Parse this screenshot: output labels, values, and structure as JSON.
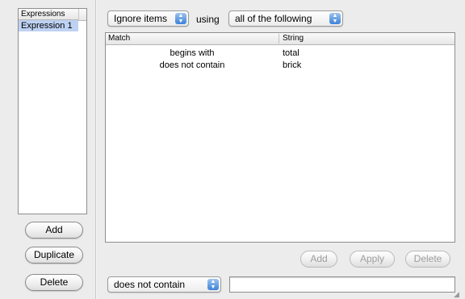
{
  "expressions": {
    "header": "Expressions",
    "items": [
      "Expression 1"
    ]
  },
  "left_buttons": {
    "add": "Add",
    "duplicate": "Duplicate",
    "delete": "Delete"
  },
  "rule": {
    "action_popup": "Ignore items",
    "using_label": "using",
    "mode_popup": "all of the following"
  },
  "table": {
    "columns": [
      "Match",
      "String"
    ],
    "rows": [
      {
        "match": "begins with",
        "string": "total"
      },
      {
        "match": "does not contain",
        "string": "brick"
      }
    ]
  },
  "table_buttons": {
    "add": "Add",
    "apply": "Apply",
    "delete": "Delete"
  },
  "condition": {
    "match_popup": "does not contain",
    "string_value": ""
  },
  "icons": {
    "popup_arrows": "up-down-arrows-icon",
    "resize": "resize-grip-icon"
  },
  "colors": {
    "selection": "#bed2f3",
    "popup_arrow_accent": "#3b82d9"
  }
}
